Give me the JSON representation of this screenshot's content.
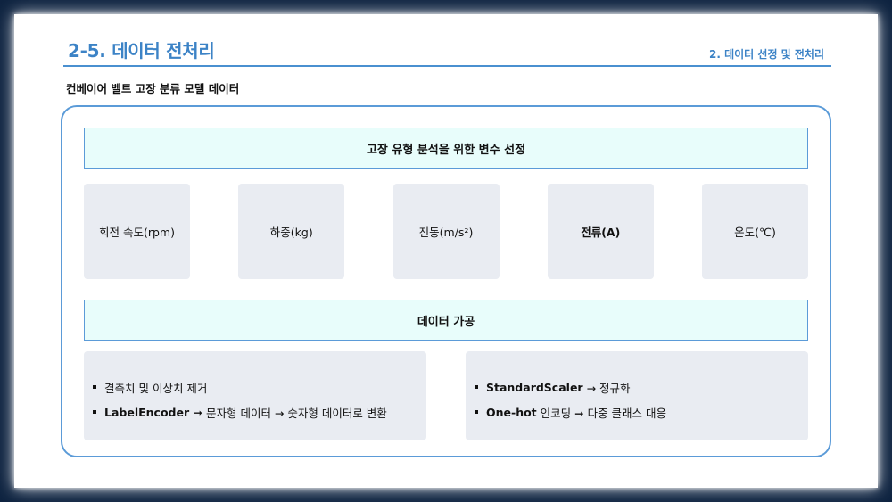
{
  "header": {
    "title": "2-5. 데이터 전처리",
    "section": "2. 데이터 선정 및 전처리"
  },
  "subtitle": "컨베이어 벨트 고장 분류 모델 데이터",
  "banners": {
    "variables": "고장 유형 분석을 위한 변수 선정",
    "processing": "데이터 가공"
  },
  "variables": [
    {
      "label": "회전 속도(rpm)"
    },
    {
      "label": "하중(kg)"
    },
    {
      "label": "진동(m/s²)"
    },
    {
      "label": "전류(A)"
    },
    {
      "label": "온도(℃)"
    }
  ],
  "processing": {
    "left": [
      {
        "strong": "",
        "text": "결측치 및 이상치 제거"
      },
      {
        "strong": "LabelEncoder ➞",
        "text": "문자형 데이터 → 숫자형 데이터로 변환"
      }
    ],
    "right": [
      {
        "strong": "StandardScaler",
        "text": "→ 정규화"
      },
      {
        "strong": "One-hot",
        "text": "인코딩 ➞ 다중 클래스 대응"
      }
    ]
  },
  "colors": {
    "background": "#0e2340",
    "accent": "#3c83c6",
    "banner_fill": "#e8fdfb",
    "card_fill": "#e9ecf2"
  }
}
